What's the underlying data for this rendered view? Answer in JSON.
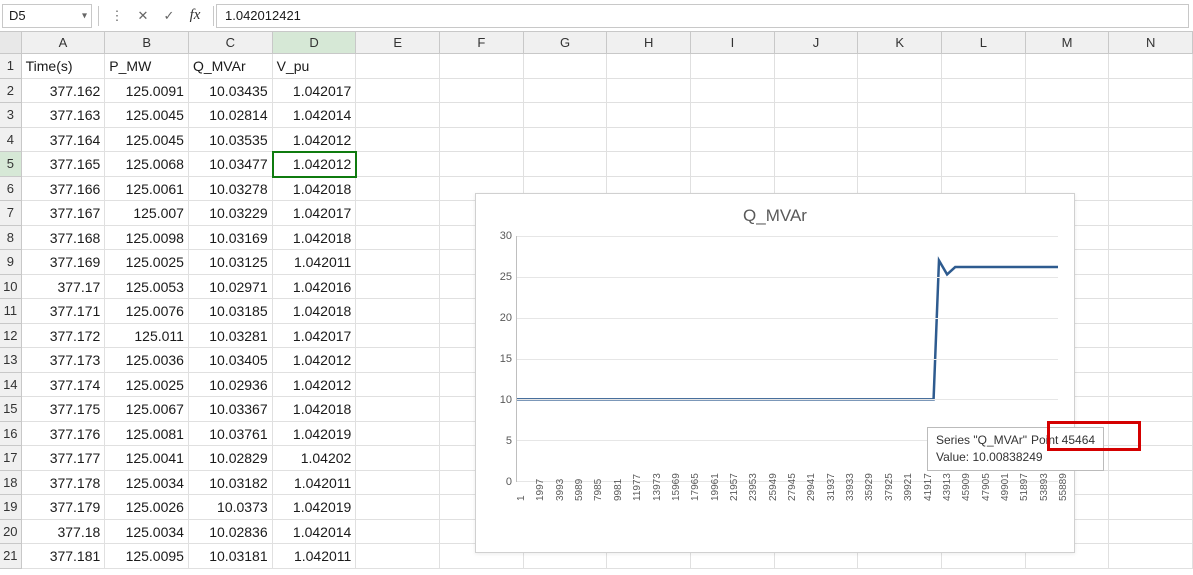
{
  "formula_bar": {
    "cell_ref": "D5",
    "value": "1.042012421"
  },
  "columns": [
    "A",
    "B",
    "C",
    "D",
    "E",
    "F",
    "G",
    "H",
    "I",
    "J",
    "K",
    "L",
    "M",
    "N"
  ],
  "headers": {
    "A": "Time(s)",
    "B": "P_MW",
    "C": "Q_MVAr",
    "D": "V_pu"
  },
  "row_nums": [
    "1",
    "2",
    "3",
    "4",
    "5",
    "6",
    "7",
    "8",
    "9",
    "10",
    "11",
    "12",
    "13",
    "14",
    "15",
    "16",
    "17",
    "18",
    "19",
    "20",
    "21"
  ],
  "rows": [
    {
      "n": "2",
      "A": "377.162",
      "B": "125.0091",
      "C": "10.03435",
      "D": "1.042017"
    },
    {
      "n": "3",
      "A": "377.163",
      "B": "125.0045",
      "C": "10.02814",
      "D": "1.042014"
    },
    {
      "n": "4",
      "A": "377.164",
      "B": "125.0045",
      "C": "10.03535",
      "D": "1.042012"
    },
    {
      "n": "5",
      "A": "377.165",
      "B": "125.0068",
      "C": "10.03477",
      "D": "1.042012"
    },
    {
      "n": "6",
      "A": "377.166",
      "B": "125.0061",
      "C": "10.03278",
      "D": "1.042018"
    },
    {
      "n": "7",
      "A": "377.167",
      "B": "125.007",
      "C": "10.03229",
      "D": "1.042017"
    },
    {
      "n": "8",
      "A": "377.168",
      "B": "125.0098",
      "C": "10.03169",
      "D": "1.042018"
    },
    {
      "n": "9",
      "A": "377.169",
      "B": "125.0025",
      "C": "10.03125",
      "D": "1.042011"
    },
    {
      "n": "10",
      "A": "377.17",
      "B": "125.0053",
      "C": "10.02971",
      "D": "1.042016"
    },
    {
      "n": "11",
      "A": "377.171",
      "B": "125.0076",
      "C": "10.03185",
      "D": "1.042018"
    },
    {
      "n": "12",
      "A": "377.172",
      "B": "125.011",
      "C": "10.03281",
      "D": "1.042017"
    },
    {
      "n": "13",
      "A": "377.173",
      "B": "125.0036",
      "C": "10.03405",
      "D": "1.042012"
    },
    {
      "n": "14",
      "A": "377.174",
      "B": "125.0025",
      "C": "10.02936",
      "D": "1.042012"
    },
    {
      "n": "15",
      "A": "377.175",
      "B": "125.0067",
      "C": "10.03367",
      "D": "1.042018"
    },
    {
      "n": "16",
      "A": "377.176",
      "B": "125.0081",
      "C": "10.03761",
      "D": "1.042019"
    },
    {
      "n": "17",
      "A": "377.177",
      "B": "125.0041",
      "C": "10.02829",
      "D": "1.04202"
    },
    {
      "n": "18",
      "A": "377.178",
      "B": "125.0034",
      "C": "10.03182",
      "D": "1.042011"
    },
    {
      "n": "19",
      "A": "377.179",
      "B": "125.0026",
      "C": "10.0373",
      "D": "1.042019"
    },
    {
      "n": "20",
      "A": "377.18",
      "B": "125.0034",
      "C": "10.02836",
      "D": "1.042014"
    },
    {
      "n": "21",
      "A": "377.181",
      "B": "125.0095",
      "C": "10.03181",
      "D": "1.042011"
    }
  ],
  "selected_cell": {
    "row": "5",
    "col": "D"
  },
  "tooltip": {
    "series_label": "Series \"Q_MVAr\"",
    "point_label": "Point 45464",
    "value_label": "Value: 10.00838249"
  },
  "chart_data": {
    "type": "line",
    "title": "Q_MVAr",
    "xlabel": "",
    "ylabel": "",
    "ylim": [
      0,
      30
    ],
    "y_ticks": [
      0,
      5,
      10,
      15,
      20,
      25,
      30
    ],
    "x_ticks": [
      "1",
      "1997",
      "3993",
      "5989",
      "7985",
      "9981",
      "11977",
      "13973",
      "15969",
      "17965",
      "19961",
      "21957",
      "23953",
      "25949",
      "27945",
      "29941",
      "31937",
      "33933",
      "35929",
      "37925",
      "39921",
      "41917",
      "43913",
      "45909",
      "47905",
      "49901",
      "51897",
      "53893",
      "55889"
    ],
    "note": "Series is flat ~10 until ~x=44000, spikes to ~27, dips to ~25.3, settles ~26",
    "series": [
      {
        "name": "Q_MVAr",
        "approx_points": [
          {
            "x_frac": 0.0,
            "y": 10.0
          },
          {
            "x_frac": 0.77,
            "y": 10.0
          },
          {
            "x_frac": 0.78,
            "y": 27.0
          },
          {
            "x_frac": 0.795,
            "y": 25.3
          },
          {
            "x_frac": 0.81,
            "y": 26.2
          },
          {
            "x_frac": 1.0,
            "y": 26.2
          }
        ]
      }
    ]
  }
}
